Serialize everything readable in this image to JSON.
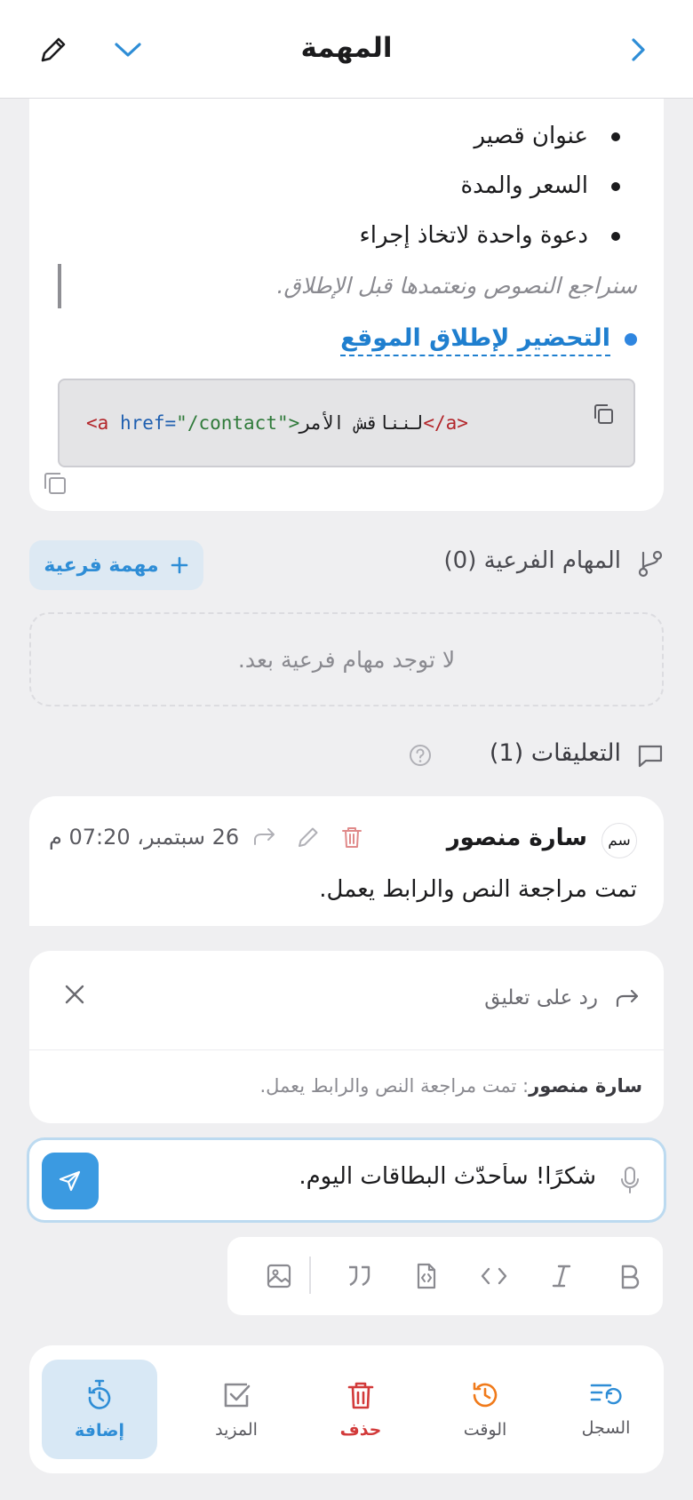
{
  "header": {
    "title": "المهمة"
  },
  "description": {
    "bullets": [
      "عنوان قصير",
      "السعر والمدة",
      "دعوة واحدة لاتخاذ إجراء"
    ],
    "quote": "سنراجع النصوص ونعتمدها قبل الإطلاق.",
    "link_text": "التحضير لإطلاق الموقع",
    "code": {
      "open_tag": "<a",
      "attr": "href=",
      "value": "\"/contact\">",
      "text": "لنناقش الأمر",
      "close_tag": "</a>"
    }
  },
  "subtasks": {
    "title": "المهام الفرعية (0)",
    "add_label": "مهمة فرعية",
    "empty_text": "لا توجد مهام فرعية بعد."
  },
  "comments": {
    "title": "التعليقات (1)",
    "items": [
      {
        "avatar": "سم",
        "author": "سارة منصور",
        "timestamp": "26 سبتمبر، 07:20 م",
        "body": "تمت مراجعة النص والرابط يعمل."
      }
    ]
  },
  "reply": {
    "label": "رد على تعليق",
    "quoted_author": "سارة منصور",
    "quoted_sep": ": ",
    "quoted_text": "تمت مراجعة النص والرابط يعمل."
  },
  "composer": {
    "value": "شكرًا! سأحدّث البطاقات اليوم."
  },
  "actions": {
    "history": "السجل",
    "time": "الوقت",
    "delete": "حذف",
    "more": "المزيد",
    "add": "إضافة"
  },
  "colors": {
    "accent": "#3b9ae1",
    "link": "#1f7fcf",
    "danger": "#d23a3a",
    "warning": "#f07a1a",
    "background": "#efeff1"
  },
  "icons": {
    "header": [
      "chevron-right-icon",
      "chevron-down-icon",
      "pencil-icon"
    ],
    "format_bar": [
      "bold-icon",
      "italic-icon",
      "code-icon",
      "code-file-icon",
      "quote-icon",
      "image-icon"
    ]
  }
}
